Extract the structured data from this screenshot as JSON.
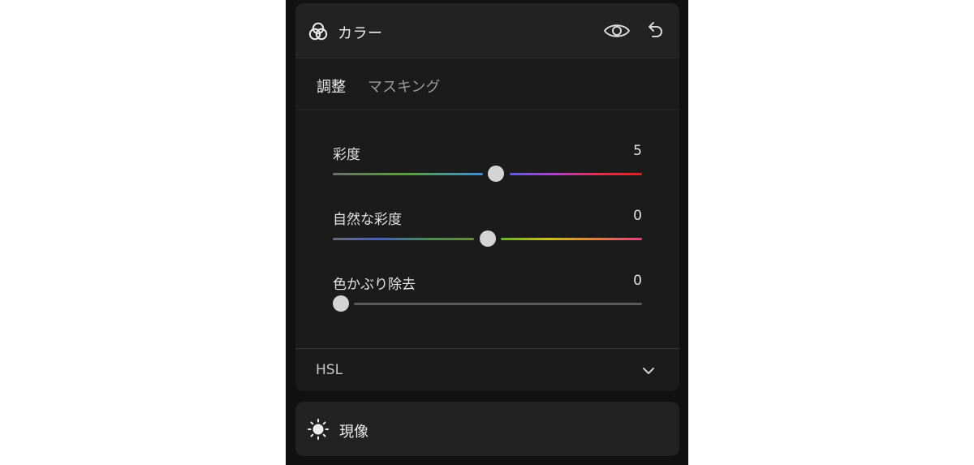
{
  "color_panel": {
    "title": "カラー",
    "icons": {
      "panel": "color-circles-icon",
      "visibility": "eye-icon",
      "reset": "undo-icon"
    },
    "tabs": [
      {
        "label": "調整",
        "active": true
      },
      {
        "label": "マスキング",
        "active": false
      }
    ],
    "sliders": [
      {
        "label": "彩度",
        "value": "5",
        "level": 0.53
      },
      {
        "label": "自然な彩度",
        "value": "0",
        "level": 0.5
      },
      {
        "label": "色かぶり除去",
        "value": "0",
        "level": 0.0
      }
    ],
    "hsl": {
      "label": "HSL",
      "icon": "chevron-down-icon"
    }
  },
  "develop_panel": {
    "title": "現像",
    "icon": "sun-icon"
  },
  "colors": {
    "panel_bg": "#1b1b1b",
    "header_bg": "#222222",
    "thumb": "#d4d4d4",
    "track_neutral": "#5a5a5a"
  }
}
